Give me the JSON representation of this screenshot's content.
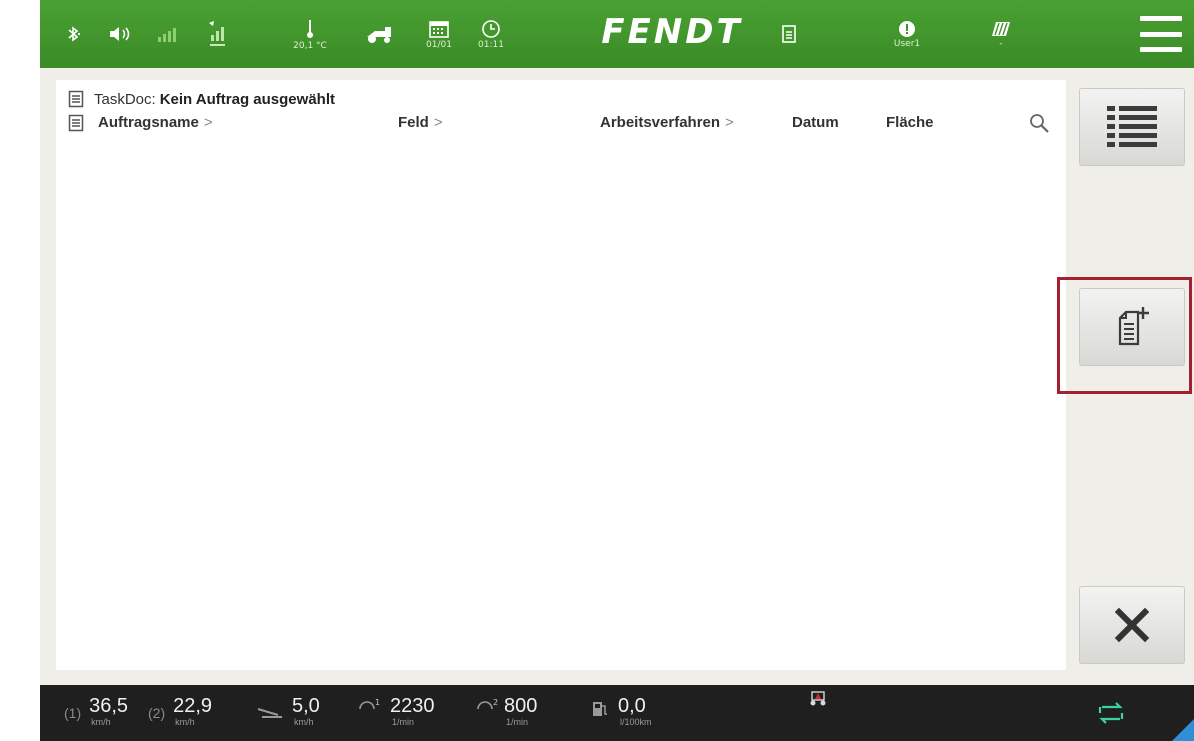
{
  "statusbar": {
    "temperature": "20,1 °C",
    "date": "01/01",
    "time": "01:11",
    "brand": "FENDT",
    "user": "User1",
    "implement_value": "-"
  },
  "taskdoc": {
    "prefix": "TaskDoc:",
    "status": "Kein Auftrag ausgewählt"
  },
  "table": {
    "columns": [
      {
        "label": "Auftragsname",
        "sortable": true
      },
      {
        "label": "Feld",
        "sortable": true
      },
      {
        "label": "Arbeitsverfahren",
        "sortable": true
      },
      {
        "label": "Datum",
        "sortable": false
      },
      {
        "label": "Fläche",
        "sortable": false
      }
    ],
    "chevron": ">",
    "rows": []
  },
  "sidebar": {
    "buttons": [
      {
        "name": "list-view-button",
        "icon": "list-icon"
      },
      {
        "name": "new-task-button",
        "icon": "document-add-icon",
        "highlighted": true
      },
      {
        "name": "close-button",
        "icon": "close-icon"
      }
    ]
  },
  "bottombar": {
    "speed1": {
      "value": "36,5",
      "unit": "km/h"
    },
    "speed2": {
      "value": "22,9",
      "unit": "km/h"
    },
    "speed3": {
      "value": "5,0",
      "unit": "km/h"
    },
    "rpm1": {
      "value": "2230",
      "unit": "1/min"
    },
    "rpm2": {
      "value": "800",
      "unit": "1/min"
    },
    "fuel": {
      "value": "0,0",
      "unit": "l/100km"
    }
  },
  "colors": {
    "brand_green": "#3f952a",
    "highlight_red": "#a3202e",
    "bottom_bar": "#1f1f1f"
  }
}
